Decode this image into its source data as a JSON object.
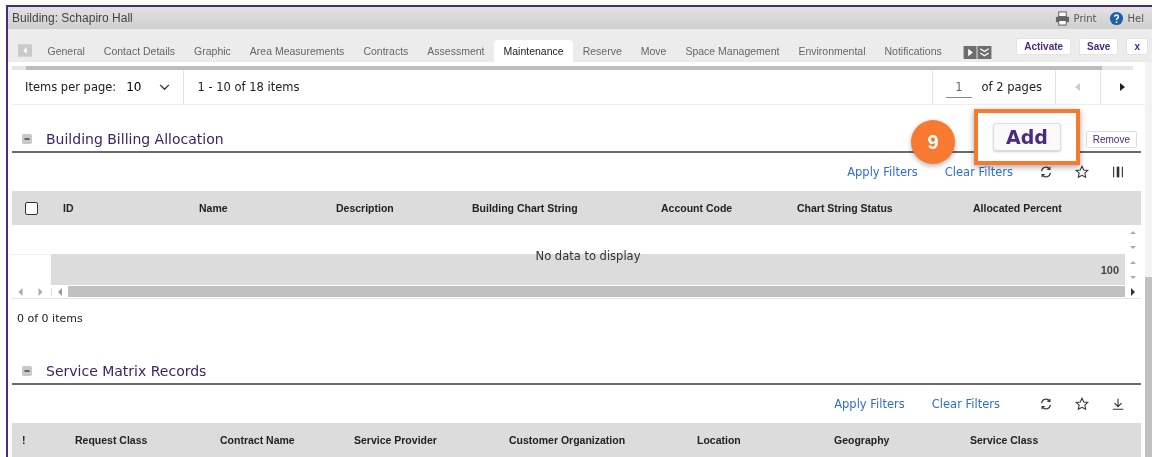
{
  "window": {
    "title": "Building: Schapiro Hall"
  },
  "header_actions": [
    {
      "kind": "print",
      "label": "Print"
    },
    {
      "kind": "help",
      "label": "Hel"
    }
  ],
  "tabs": [
    {
      "label": "General",
      "selected": false
    },
    {
      "label": "Contact Details",
      "selected": false
    },
    {
      "label": "Graphic",
      "selected": false
    },
    {
      "label": "Area Measurements",
      "selected": false
    },
    {
      "label": "Contracts",
      "selected": false
    },
    {
      "label": "Assessment",
      "selected": false
    },
    {
      "label": "Maintenance",
      "selected": true
    },
    {
      "label": "Reserve",
      "selected": false
    },
    {
      "label": "Move",
      "selected": false
    },
    {
      "label": "Space Management",
      "selected": false
    },
    {
      "label": "Environmental",
      "selected": false
    },
    {
      "label": "Notifications",
      "selected": false
    }
  ],
  "tab_buttons": [
    "Activate",
    "Save",
    "x"
  ],
  "pager": {
    "items_per_page_label": "Items per page:",
    "items_per_page": "10",
    "range": "1 - 10 of 18 items",
    "page": "1",
    "of_pages": "of 2 pages"
  },
  "sections": [
    {
      "title": "Building Billing Allocation",
      "expanded": true,
      "buttons": [
        "Remove"
      ],
      "filters": [
        "Apply Filters",
        "Clear Filters"
      ],
      "toolbar_icons": [
        {
          "kind": "refresh"
        },
        {
          "kind": "star"
        },
        {
          "kind": "columns"
        }
      ],
      "select_all": {
        "checked": false
      },
      "columns": [
        "ID",
        "Name",
        "Description",
        "Building Chart String",
        "Account Code",
        "Chart String Status",
        "Allocated Percent"
      ],
      "empty_message": "No data to display",
      "row_value": "100",
      "footer": "0 of 0 items"
    },
    {
      "title": "Service Matrix Records",
      "expanded": true,
      "filters": [
        "Apply Filters",
        "Clear Filters"
      ],
      "toolbar_icons": [
        {
          "kind": "refresh"
        },
        {
          "kind": "star"
        },
        {
          "kind": "download"
        }
      ],
      "columns": [
        "!",
        "Request Class",
        "Contract Name",
        "Service Provider",
        "Customer Organization",
        "Location",
        "Geography",
        "Service Class"
      ]
    }
  ],
  "callout": {
    "number": "9",
    "label": "Add"
  }
}
